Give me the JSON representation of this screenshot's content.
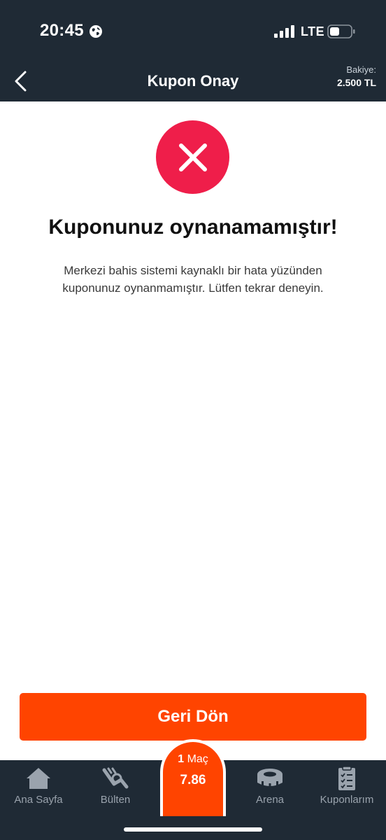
{
  "status_bar": {
    "time": "20:45",
    "network": "LTE",
    "icons": [
      "globe-icon",
      "signal-icon",
      "battery-icon"
    ]
  },
  "nav": {
    "back_icon": "chevron-left-icon",
    "title": "Kupon Onay",
    "balance_label": "Bakiye:",
    "balance_value": "2.500 TL"
  },
  "result": {
    "icon": "error-x-icon",
    "title": "Kuponunuz oynanamamıştır!",
    "message": "Merkezi bahis sistemi kaynaklı bir hata yüzünden kuponunuz oynanmamıştır. Lütfen tekrar deneyin."
  },
  "primary_action": {
    "label": "Geri Dön"
  },
  "tabbar": {
    "tabs": [
      {
        "label": "Ana Sayfa",
        "icon": "home-icon"
      },
      {
        "label": "Bülten",
        "icon": "bulletin-icon"
      },
      {
        "label": "Arena",
        "icon": "arena-stadium-icon"
      },
      {
        "label": "Kuponlarım",
        "icon": "clipboard-list-icon"
      }
    ],
    "coupon": {
      "count": "1",
      "count_label": "Maç",
      "odds": "7.86"
    }
  },
  "colors": {
    "header_bg": "#1f2a35",
    "accent": "#ff4400",
    "error": "#ef1e4a",
    "tab_inactive": "#9aa3ad"
  }
}
